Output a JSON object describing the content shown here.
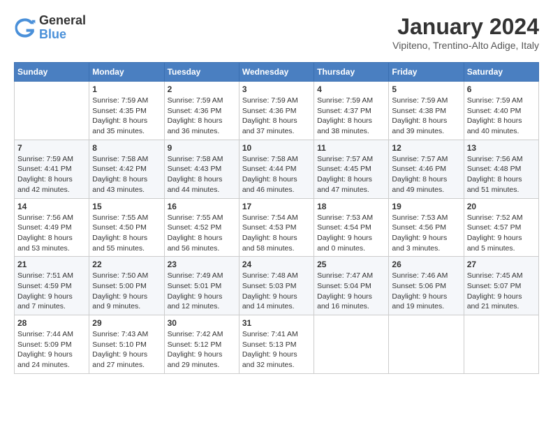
{
  "header": {
    "logo_general": "General",
    "logo_blue": "Blue",
    "month_title": "January 2024",
    "location": "Vipiteno, Trentino-Alto Adige, Italy"
  },
  "days_of_week": [
    "Sunday",
    "Monday",
    "Tuesday",
    "Wednesday",
    "Thursday",
    "Friday",
    "Saturday"
  ],
  "weeks": [
    [
      {
        "num": "",
        "lines": []
      },
      {
        "num": "1",
        "lines": [
          "Sunrise: 7:59 AM",
          "Sunset: 4:35 PM",
          "Daylight: 8 hours",
          "and 35 minutes."
        ]
      },
      {
        "num": "2",
        "lines": [
          "Sunrise: 7:59 AM",
          "Sunset: 4:36 PM",
          "Daylight: 8 hours",
          "and 36 minutes."
        ]
      },
      {
        "num": "3",
        "lines": [
          "Sunrise: 7:59 AM",
          "Sunset: 4:36 PM",
          "Daylight: 8 hours",
          "and 37 minutes."
        ]
      },
      {
        "num": "4",
        "lines": [
          "Sunrise: 7:59 AM",
          "Sunset: 4:37 PM",
          "Daylight: 8 hours",
          "and 38 minutes."
        ]
      },
      {
        "num": "5",
        "lines": [
          "Sunrise: 7:59 AM",
          "Sunset: 4:38 PM",
          "Daylight: 8 hours",
          "and 39 minutes."
        ]
      },
      {
        "num": "6",
        "lines": [
          "Sunrise: 7:59 AM",
          "Sunset: 4:40 PM",
          "Daylight: 8 hours",
          "and 40 minutes."
        ]
      }
    ],
    [
      {
        "num": "7",
        "lines": [
          "Sunrise: 7:59 AM",
          "Sunset: 4:41 PM",
          "Daylight: 8 hours",
          "and 42 minutes."
        ]
      },
      {
        "num": "8",
        "lines": [
          "Sunrise: 7:58 AM",
          "Sunset: 4:42 PM",
          "Daylight: 8 hours",
          "and 43 minutes."
        ]
      },
      {
        "num": "9",
        "lines": [
          "Sunrise: 7:58 AM",
          "Sunset: 4:43 PM",
          "Daylight: 8 hours",
          "and 44 minutes."
        ]
      },
      {
        "num": "10",
        "lines": [
          "Sunrise: 7:58 AM",
          "Sunset: 4:44 PM",
          "Daylight: 8 hours",
          "and 46 minutes."
        ]
      },
      {
        "num": "11",
        "lines": [
          "Sunrise: 7:57 AM",
          "Sunset: 4:45 PM",
          "Daylight: 8 hours",
          "and 47 minutes."
        ]
      },
      {
        "num": "12",
        "lines": [
          "Sunrise: 7:57 AM",
          "Sunset: 4:46 PM",
          "Daylight: 8 hours",
          "and 49 minutes."
        ]
      },
      {
        "num": "13",
        "lines": [
          "Sunrise: 7:56 AM",
          "Sunset: 4:48 PM",
          "Daylight: 8 hours",
          "and 51 minutes."
        ]
      }
    ],
    [
      {
        "num": "14",
        "lines": [
          "Sunrise: 7:56 AM",
          "Sunset: 4:49 PM",
          "Daylight: 8 hours",
          "and 53 minutes."
        ]
      },
      {
        "num": "15",
        "lines": [
          "Sunrise: 7:55 AM",
          "Sunset: 4:50 PM",
          "Daylight: 8 hours",
          "and 55 minutes."
        ]
      },
      {
        "num": "16",
        "lines": [
          "Sunrise: 7:55 AM",
          "Sunset: 4:52 PM",
          "Daylight: 8 hours",
          "and 56 minutes."
        ]
      },
      {
        "num": "17",
        "lines": [
          "Sunrise: 7:54 AM",
          "Sunset: 4:53 PM",
          "Daylight: 8 hours",
          "and 58 minutes."
        ]
      },
      {
        "num": "18",
        "lines": [
          "Sunrise: 7:53 AM",
          "Sunset: 4:54 PM",
          "Daylight: 9 hours",
          "and 0 minutes."
        ]
      },
      {
        "num": "19",
        "lines": [
          "Sunrise: 7:53 AM",
          "Sunset: 4:56 PM",
          "Daylight: 9 hours",
          "and 3 minutes."
        ]
      },
      {
        "num": "20",
        "lines": [
          "Sunrise: 7:52 AM",
          "Sunset: 4:57 PM",
          "Daylight: 9 hours",
          "and 5 minutes."
        ]
      }
    ],
    [
      {
        "num": "21",
        "lines": [
          "Sunrise: 7:51 AM",
          "Sunset: 4:59 PM",
          "Daylight: 9 hours",
          "and 7 minutes."
        ]
      },
      {
        "num": "22",
        "lines": [
          "Sunrise: 7:50 AM",
          "Sunset: 5:00 PM",
          "Daylight: 9 hours",
          "and 9 minutes."
        ]
      },
      {
        "num": "23",
        "lines": [
          "Sunrise: 7:49 AM",
          "Sunset: 5:01 PM",
          "Daylight: 9 hours",
          "and 12 minutes."
        ]
      },
      {
        "num": "24",
        "lines": [
          "Sunrise: 7:48 AM",
          "Sunset: 5:03 PM",
          "Daylight: 9 hours",
          "and 14 minutes."
        ]
      },
      {
        "num": "25",
        "lines": [
          "Sunrise: 7:47 AM",
          "Sunset: 5:04 PM",
          "Daylight: 9 hours",
          "and 16 minutes."
        ]
      },
      {
        "num": "26",
        "lines": [
          "Sunrise: 7:46 AM",
          "Sunset: 5:06 PM",
          "Daylight: 9 hours",
          "and 19 minutes."
        ]
      },
      {
        "num": "27",
        "lines": [
          "Sunrise: 7:45 AM",
          "Sunset: 5:07 PM",
          "Daylight: 9 hours",
          "and 21 minutes."
        ]
      }
    ],
    [
      {
        "num": "28",
        "lines": [
          "Sunrise: 7:44 AM",
          "Sunset: 5:09 PM",
          "Daylight: 9 hours",
          "and 24 minutes."
        ]
      },
      {
        "num": "29",
        "lines": [
          "Sunrise: 7:43 AM",
          "Sunset: 5:10 PM",
          "Daylight: 9 hours",
          "and 27 minutes."
        ]
      },
      {
        "num": "30",
        "lines": [
          "Sunrise: 7:42 AM",
          "Sunset: 5:12 PM",
          "Daylight: 9 hours",
          "and 29 minutes."
        ]
      },
      {
        "num": "31",
        "lines": [
          "Sunrise: 7:41 AM",
          "Sunset: 5:13 PM",
          "Daylight: 9 hours",
          "and 32 minutes."
        ]
      },
      {
        "num": "",
        "lines": []
      },
      {
        "num": "",
        "lines": []
      },
      {
        "num": "",
        "lines": []
      }
    ]
  ]
}
